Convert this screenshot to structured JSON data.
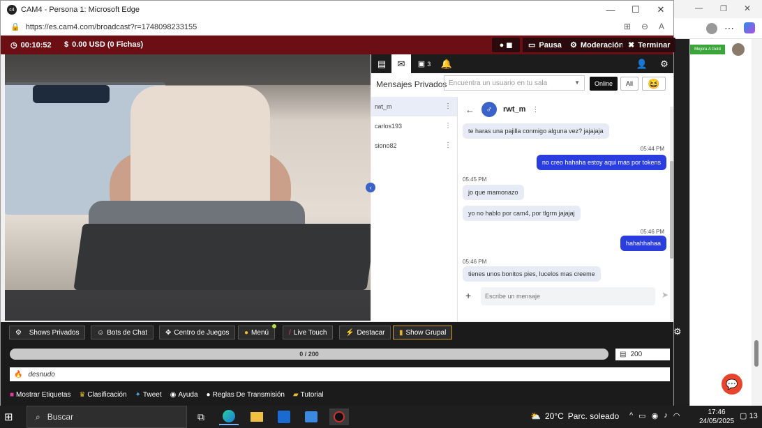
{
  "browser": {
    "window_title": "CAM4 - Persona 1: Microsoft Edge",
    "url": "https://es.cam4.com/broadcast?r=1748098233155"
  },
  "topbar": {
    "timer": "00:10:52",
    "earnings": "0.00 USD (0 Fichas)",
    "pause_label": "Pausa",
    "moderation_label": "Moderación",
    "end_label": "Terminar"
  },
  "chat": {
    "viewers_count": "3",
    "pm_title": "Mensajes Privados",
    "search_placeholder": "Encuentra un usuario en tu sala",
    "filter_online": "Online",
    "filter_all": "All",
    "users": [
      {
        "name": "rwt_m"
      },
      {
        "name": "carlos193"
      },
      {
        "name": "siono82"
      }
    ],
    "conversation": {
      "name": "rwt_m",
      "messages": [
        {
          "dir": "in",
          "text": "te haras una pajilla conmigo alguna vez? jajajaja"
        },
        {
          "time": "05:44 PM"
        },
        {
          "dir": "out",
          "text": "no creo hahaha  estoy aqui mas por tokens"
        },
        {
          "time": "05:45 PM"
        },
        {
          "dir": "in",
          "text": "jo que mamonazo"
        },
        {
          "dir": "in",
          "text": "yo no hablo por cam4, por tlgrm jajajaj"
        },
        {
          "time": "05:46 PM"
        },
        {
          "dir": "out",
          "text": "hahahhahaa"
        },
        {
          "time": "05:46 PM"
        },
        {
          "dir": "in",
          "text": "tienes unos bonitos pies, lucelos mas creeme"
        }
      ],
      "compose_placeholder": "Escribe un mensaje"
    }
  },
  "toolbar": {
    "buttons": [
      {
        "label": "Shows Privados"
      },
      {
        "label": "Bots de Chat"
      },
      {
        "label": "Centro de Juegos"
      },
      {
        "label": "Menú"
      },
      {
        "label": "Live Touch"
      },
      {
        "label": "Destacar"
      },
      {
        "label": "Show Grupal"
      }
    ]
  },
  "goal": {
    "progress_text": "0 / 200",
    "progress_fraction": 0,
    "goal_value": "200"
  },
  "topic": "desnudo",
  "links": [
    {
      "label": "Mostrar Etiquetas"
    },
    {
      "label": "Clasificación"
    },
    {
      "label": "Tweet"
    },
    {
      "label": "Ayuda"
    },
    {
      "label": "Reglas De Transmisión"
    },
    {
      "label": "Tutorial"
    }
  ],
  "background": {
    "gold_badge": "Mejora A Gold"
  },
  "taskbar": {
    "search_label": "Buscar",
    "weather_temp": "20°C",
    "weather_desc": "Parc. soleado",
    "time": "17:46",
    "date": "24/05/2025",
    "notifications": "13"
  },
  "colors": {
    "topbar": "#6b0f14",
    "accent_blue": "#2a3ee0",
    "dark": "#1b1b1b"
  }
}
